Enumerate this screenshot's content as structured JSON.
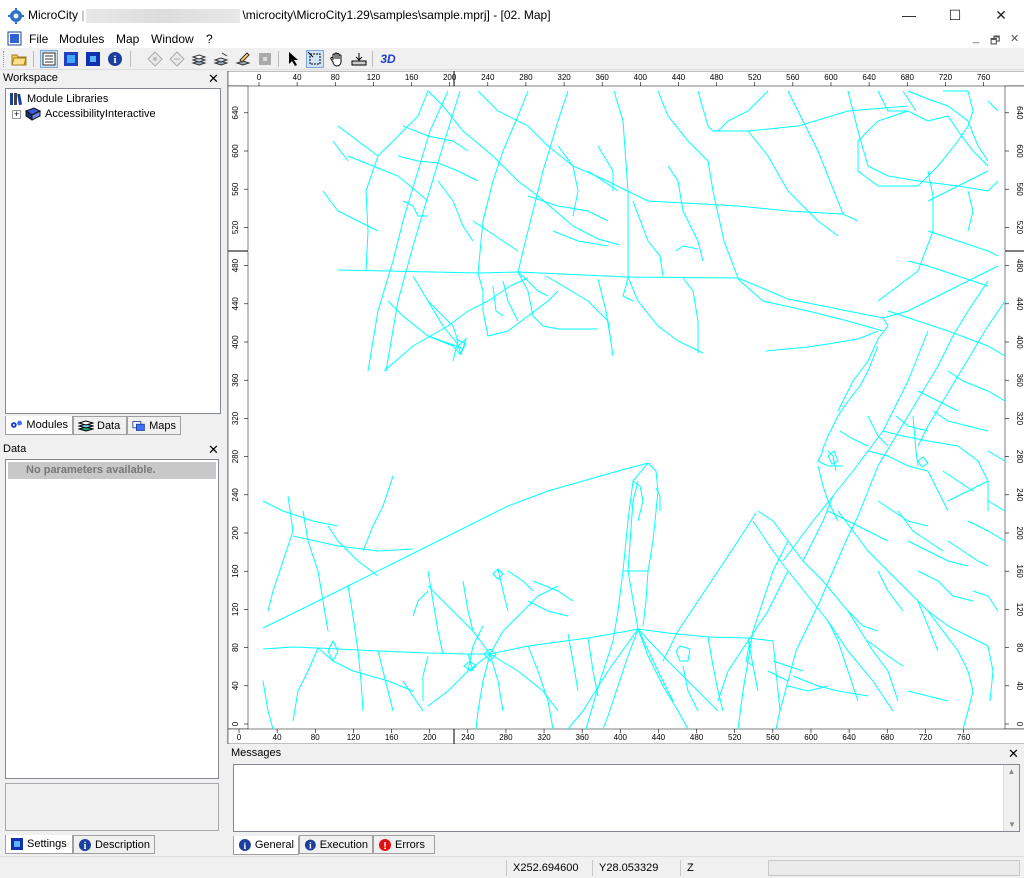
{
  "window": {
    "app_name": "MicroCity",
    "separator": "|",
    "path_suffix": "\\microcity\\MicroCity1.29\\samples\\sample.mprj]",
    "doc_title": "- [02. Map]",
    "minimize_label": "—",
    "maximize_label": "☐",
    "close_label": "✕"
  },
  "menu": {
    "items": [
      "File",
      "Modules",
      "Map",
      "Window",
      "?"
    ],
    "mdi_controls": [
      "_",
      "🗗",
      "✕"
    ]
  },
  "toolbar": {
    "buttons": [
      "open-folder",
      "list-view",
      "blue-box",
      "blue-square",
      "info",
      "node-tool",
      "node-tool-2",
      "stack-1",
      "stack-2",
      "stack-3",
      "gray-square",
      "arrow-select",
      "zoom-rect",
      "pan-hand",
      "zoom-full",
      "3d-view"
    ],
    "label_3d": "3D"
  },
  "workspace": {
    "title": "Workspace",
    "close": "✕",
    "tree": [
      {
        "label": "Module Libraries",
        "level": 0
      },
      {
        "label": "AccessibilityInteractive",
        "level": 1
      }
    ],
    "tabs": [
      "Modules",
      "Data",
      "Maps"
    ]
  },
  "data_panel": {
    "title": "Data",
    "close": "✕",
    "empty_text": "No parameters available.",
    "tabs": [
      "Settings",
      "Description"
    ]
  },
  "map": {
    "top_ticks": [
      "0",
      "40",
      "80",
      "120",
      "160",
      "200",
      "240",
      "280",
      "320",
      "360",
      "400",
      "440",
      "480",
      "520",
      "560",
      "600",
      "640",
      "680",
      "720",
      "760"
    ],
    "bottom_ticks": [
      "0",
      "40",
      "80",
      "120",
      "160",
      "200",
      "240",
      "280",
      "320",
      "360",
      "400",
      "440",
      "480",
      "520",
      "560",
      "600",
      "640",
      "680",
      "720",
      "760"
    ],
    "left_ticks": [
      "640",
      "600",
      "560",
      "520",
      "480",
      "440",
      "400",
      "360",
      "320",
      "280",
      "240",
      "200",
      "160",
      "120",
      "80",
      "40",
      "0"
    ],
    "right_ticks": [
      "640",
      "600",
      "560",
      "520",
      "480",
      "440",
      "400",
      "360",
      "320",
      "280",
      "240",
      "200",
      "160",
      "120",
      "80",
      "40",
      "0"
    ],
    "road_color": "#00ffff"
  },
  "messages": {
    "title": "Messages",
    "close": "✕",
    "tabs": [
      "General",
      "Execution",
      "Errors"
    ]
  },
  "status": {
    "x": "X252.694600",
    "y": "Y28.053329",
    "z": "Z"
  }
}
